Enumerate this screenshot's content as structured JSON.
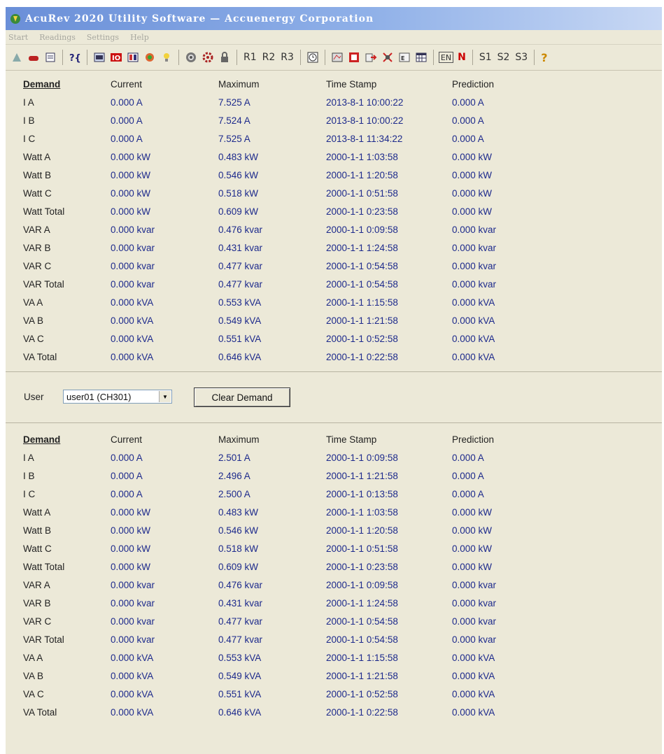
{
  "window": {
    "title": "AcuRev 2020 Utility Software  —  Accuenergy Corporation"
  },
  "menu": [
    "Start",
    "Readings",
    "Settings",
    "Help"
  ],
  "toolbar": {
    "group1": [
      "settings-icon",
      "meter-icon",
      "list-icon"
    ],
    "group2": [
      "help-config-icon"
    ],
    "group3": [
      "readings-icon",
      "io-icon",
      "grid-icon",
      "map-icon",
      "bulb-icon"
    ],
    "group4": [
      "target-icon",
      "gear-icon",
      "lock-icon"
    ],
    "r_labels": [
      "R1",
      "R2",
      "R3"
    ],
    "group5": [
      "clock-icon"
    ],
    "group6": [
      "event-icon",
      "report-icon",
      "export-icon",
      "log-icon",
      "energy-log-icon",
      "calendar-icon"
    ],
    "en_label": "EN",
    "n_label": "N",
    "s_labels": [
      "S1",
      "S2",
      "S3"
    ],
    "help_label": "?"
  },
  "columns": [
    "Demand",
    "Current",
    "Maximum",
    "Time Stamp",
    "Prediction"
  ],
  "upper_rows": [
    [
      "I A",
      "0.000 A",
      "7.525 A",
      "2013-8-1 10:00:22",
      "0.000 A"
    ],
    [
      "I B",
      "0.000 A",
      "7.524 A",
      "2013-8-1 10:00:22",
      "0.000 A"
    ],
    [
      "I C",
      "0.000 A",
      "7.525 A",
      "2013-8-1 11:34:22",
      "0.000 A"
    ],
    [
      "Watt A",
      "0.000 kW",
      "0.483 kW",
      "2000-1-1 1:03:58",
      "0.000 kW"
    ],
    [
      "Watt B",
      "0.000 kW",
      "0.546 kW",
      "2000-1-1 1:20:58",
      "0.000 kW"
    ],
    [
      "Watt C",
      "0.000 kW",
      "0.518 kW",
      "2000-1-1 0:51:58",
      "0.000 kW"
    ],
    [
      "Watt Total",
      "0.000 kW",
      "0.609 kW",
      "2000-1-1 0:23:58",
      "0.000 kW"
    ],
    [
      "VAR A",
      "0.000 kvar",
      "0.476 kvar",
      "2000-1-1 0:09:58",
      "0.000 kvar"
    ],
    [
      "VAR B",
      "0.000 kvar",
      "0.431 kvar",
      "2000-1-1 1:24:58",
      "0.000 kvar"
    ],
    [
      "VAR C",
      "0.000 kvar",
      "0.477 kvar",
      "2000-1-1 0:54:58",
      "0.000 kvar"
    ],
    [
      "VAR Total",
      "0.000 kvar",
      "0.477 kvar",
      "2000-1-1 0:54:58",
      "0.000 kvar"
    ],
    [
      "VA A",
      "0.000 kVA",
      "0.553 kVA",
      "2000-1-1 1:15:58",
      "0.000 kVA"
    ],
    [
      "VA B",
      "0.000 kVA",
      "0.549 kVA",
      "2000-1-1 1:21:58",
      "0.000 kVA"
    ],
    [
      "VA C",
      "0.000 kVA",
      "0.551 kVA",
      "2000-1-1 0:52:58",
      "0.000 kVA"
    ],
    [
      "VA Total",
      "0.000 kVA",
      "0.646 kVA",
      "2000-1-1 0:22:58",
      "0.000 kVA"
    ]
  ],
  "user_bar": {
    "label": "User",
    "selected": "user01 (CH301)",
    "clear_button": "Clear Demand"
  },
  "lower_rows": [
    [
      "I A",
      "0.000 A",
      "2.501 A",
      "2000-1-1 0:09:58",
      "0.000 A"
    ],
    [
      "I B",
      "0.000 A",
      "2.496 A",
      "2000-1-1 1:21:58",
      "0.000 A"
    ],
    [
      "I C",
      "0.000 A",
      "2.500 A",
      "2000-1-1 0:13:58",
      "0.000 A"
    ],
    [
      "Watt A",
      "0.000 kW",
      "0.483 kW",
      "2000-1-1 1:03:58",
      "0.000 kW"
    ],
    [
      "Watt B",
      "0.000 kW",
      "0.546 kW",
      "2000-1-1 1:20:58",
      "0.000 kW"
    ],
    [
      "Watt C",
      "0.000 kW",
      "0.518 kW",
      "2000-1-1 0:51:58",
      "0.000 kW"
    ],
    [
      "Watt Total",
      "0.000 kW",
      "0.609 kW",
      "2000-1-1 0:23:58",
      "0.000 kW"
    ],
    [
      "VAR A",
      "0.000 kvar",
      "0.476 kvar",
      "2000-1-1 0:09:58",
      "0.000 kvar"
    ],
    [
      "VAR B",
      "0.000 kvar",
      "0.431 kvar",
      "2000-1-1 1:24:58",
      "0.000 kvar"
    ],
    [
      "VAR C",
      "0.000 kvar",
      "0.477 kvar",
      "2000-1-1 0:54:58",
      "0.000 kvar"
    ],
    [
      "VAR Total",
      "0.000 kvar",
      "0.477 kvar",
      "2000-1-1 0:54:58",
      "0.000 kvar"
    ],
    [
      "VA A",
      "0.000 kVA",
      "0.553 kVA",
      "2000-1-1 1:15:58",
      "0.000 kVA"
    ],
    [
      "VA B",
      "0.000 kVA",
      "0.549 kVA",
      "2000-1-1 1:21:58",
      "0.000 kVA"
    ],
    [
      "VA C",
      "0.000 kVA",
      "0.551 kVA",
      "2000-1-1 0:52:58",
      "0.000 kVA"
    ],
    [
      "VA Total",
      "0.000 kVA",
      "0.646 kVA",
      "2000-1-1 0:22:58",
      "0.000 kVA"
    ]
  ]
}
